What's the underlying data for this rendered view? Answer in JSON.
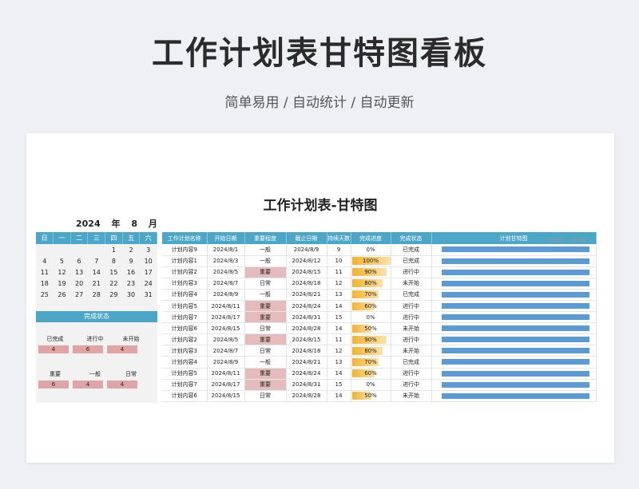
{
  "header": {
    "title": "工作计划表甘特图看板",
    "subtitle": "简单易用 / 自动统计 / 自动更新"
  },
  "sheet": {
    "title": "工作计划表-甘特图"
  },
  "calendar": {
    "year": "2024",
    "year_unit": "年",
    "month": "8",
    "month_unit": "月",
    "weekdays": [
      "日",
      "一",
      "二",
      "三",
      "四",
      "五",
      "六"
    ],
    "weeks": [
      [
        "",
        "",
        "",
        "",
        "1",
        "2",
        "3"
      ],
      [
        "4",
        "5",
        "6",
        "7",
        "8",
        "9",
        "10"
      ],
      [
        "11",
        "12",
        "13",
        "14",
        "15",
        "16",
        "17"
      ],
      [
        "18",
        "19",
        "20",
        "21",
        "22",
        "23",
        "24"
      ],
      [
        "25",
        "26",
        "27",
        "28",
        "29",
        "30",
        "31"
      ]
    ]
  },
  "status_panel": {
    "title": "完成状态",
    "status_labels": [
      "已完成",
      "进行中",
      "未开始"
    ],
    "status_values": [
      "4",
      "6",
      "4"
    ],
    "importance_labels": [
      "重要",
      "一般",
      "日常"
    ],
    "importance_values": [
      "6",
      "4",
      "4"
    ]
  },
  "plan": {
    "columns": [
      "工作计划名称",
      "开始日期",
      "重要程度",
      "截止日期",
      "持续天数",
      "完成进度",
      "完成状态",
      "计划甘特图"
    ],
    "legend": [
      "开始日期",
      "持续天数"
    ],
    "rows": [
      {
        "name": "计划内容9",
        "start": "2024/8/1",
        "importance": "一般",
        "end": "2024/8/9",
        "days": "9",
        "progress": "0%",
        "progress_value": 0,
        "status": "已完成"
      },
      {
        "name": "计划内容1",
        "start": "2024/8/3",
        "importance": "一般",
        "end": "2024/8/12",
        "days": "10",
        "progress": "100%",
        "progress_value": 100,
        "status": "已完成"
      },
      {
        "name": "计划内容2",
        "start": "2024/8/5",
        "importance": "重要",
        "end": "2024/8/15",
        "days": "11",
        "progress": "90%",
        "progress_value": 90,
        "status": "进行中"
      },
      {
        "name": "计划内容3",
        "start": "2024/8/7",
        "importance": "日常",
        "end": "2024/8/18",
        "days": "12",
        "progress": "80%",
        "progress_value": 80,
        "status": "未开始"
      },
      {
        "name": "计划内容4",
        "start": "2024/8/9",
        "importance": "一般",
        "end": "2024/8/21",
        "days": "13",
        "progress": "70%",
        "progress_value": 70,
        "status": "已完成"
      },
      {
        "name": "计划内容5",
        "start": "2024/8/11",
        "importance": "重要",
        "end": "2024/8/24",
        "days": "14",
        "progress": "60%",
        "progress_value": 60,
        "status": "进行中"
      },
      {
        "name": "计划内容7",
        "start": "2024/8/17",
        "importance": "重要",
        "end": "2024/8/31",
        "days": "15",
        "progress": "0%",
        "progress_value": 0,
        "status": "进行中"
      },
      {
        "name": "计划内容6",
        "start": "2024/8/15",
        "importance": "日常",
        "end": "2024/8/28",
        "days": "14",
        "progress": "50%",
        "progress_value": 50,
        "status": "未开始"
      },
      {
        "name": "计划内容2",
        "start": "2024/8/5",
        "importance": "重要",
        "end": "2024/8/15",
        "days": "11",
        "progress": "90%",
        "progress_value": 90,
        "status": "进行中"
      },
      {
        "name": "计划内容3",
        "start": "2024/8/7",
        "importance": "日常",
        "end": "2024/8/18",
        "days": "12",
        "progress": "80%",
        "progress_value": 80,
        "status": "未开始"
      },
      {
        "name": "计划内容4",
        "start": "2024/8/9",
        "importance": "一般",
        "end": "2024/8/21",
        "days": "13",
        "progress": "70%",
        "progress_value": 70,
        "status": "已完成"
      },
      {
        "name": "计划内容5",
        "start": "2024/8/11",
        "importance": "重要",
        "end": "2024/8/24",
        "days": "14",
        "progress": "60%",
        "progress_value": 60,
        "status": "进行中"
      },
      {
        "name": "计划内容7",
        "start": "2024/8/17",
        "importance": "重要",
        "end": "2024/8/31",
        "days": "15",
        "progress": "0%",
        "progress_value": 0,
        "status": "进行中"
      },
      {
        "name": "计划内容6",
        "start": "2024/8/15",
        "importance": "日常",
        "end": "2024/8/28",
        "days": "14",
        "progress": "50%",
        "progress_value": 50,
        "status": "未开始"
      }
    ]
  },
  "colors": {
    "header_blue": "#4ba6c8",
    "important_pink": "#e5bcbc",
    "progress_orange": "#f4b130",
    "gantt_bar": "#5b9bd5"
  }
}
